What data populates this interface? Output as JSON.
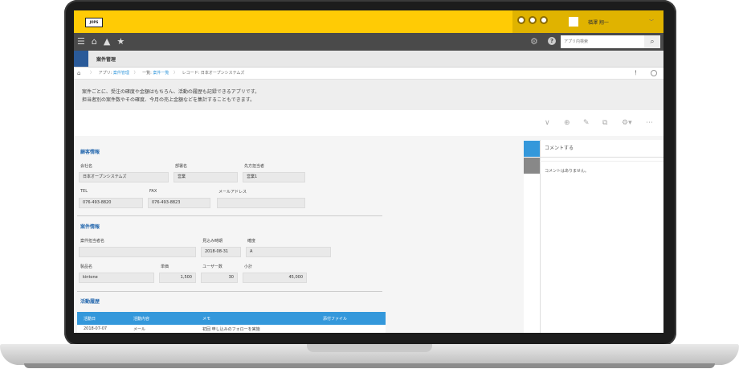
{
  "topbar": {
    "logo": "JOPS",
    "user_name": "楢澤 翔一"
  },
  "nav": {
    "search_placeholder": "アプリ内検索"
  },
  "app": {
    "title": "案件管理"
  },
  "breadcrumb": {
    "app_prefix": "アプリ:",
    "app_link": "案件管理",
    "list_prefix": "一覧:",
    "list_link": "案件一覧",
    "record": "レコード: 日本オープンシステムズ"
  },
  "description": {
    "line1": "案件ごとに、受注の確度や金額はもちろん、活動の履歴も記録できるアプリです。",
    "line2": "担当者別の案件数やその確度、今月の売上金額などを集計することもできます。"
  },
  "sidebar": {
    "comment_action": "コメントする",
    "no_comments": "コメントはありません。"
  },
  "sections": {
    "customer": {
      "title": "顧客情報",
      "company_label": "会社名",
      "company_value": "日本オープンシステムズ",
      "dept_label": "部署名",
      "dept_value": "営業",
      "contact_label": "先方担当者",
      "contact_value": "営業1",
      "tel_label": "TEL",
      "tel_value": "076-493-8820",
      "fax_label": "FAX",
      "fax_value": "076-493-8823",
      "email_label": "メールアドレス",
      "email_value": ""
    },
    "deal": {
      "title": "案件情報",
      "owner_label": "案件担当者名",
      "owner_value": "",
      "expected_label": "見込み時期",
      "expected_value": "2018-08-31",
      "certainty_label": "確度",
      "certainty_value": "A",
      "product_label": "製品名",
      "product_value": "kintone",
      "unit_label": "単価",
      "unit_value": "1,500",
      "users_label": "ユーザー数",
      "users_value": "30",
      "subtotal_label": "小計",
      "subtotal_value": "45,000"
    },
    "activity": {
      "title": "活動履歴",
      "columns": [
        "活動日",
        "活動内容",
        "メモ",
        "添付ファイル"
      ],
      "rows": [
        [
          "2018-07-07",
          "メール",
          "初回 申し込みのフォローを実施",
          ""
        ]
      ]
    }
  }
}
